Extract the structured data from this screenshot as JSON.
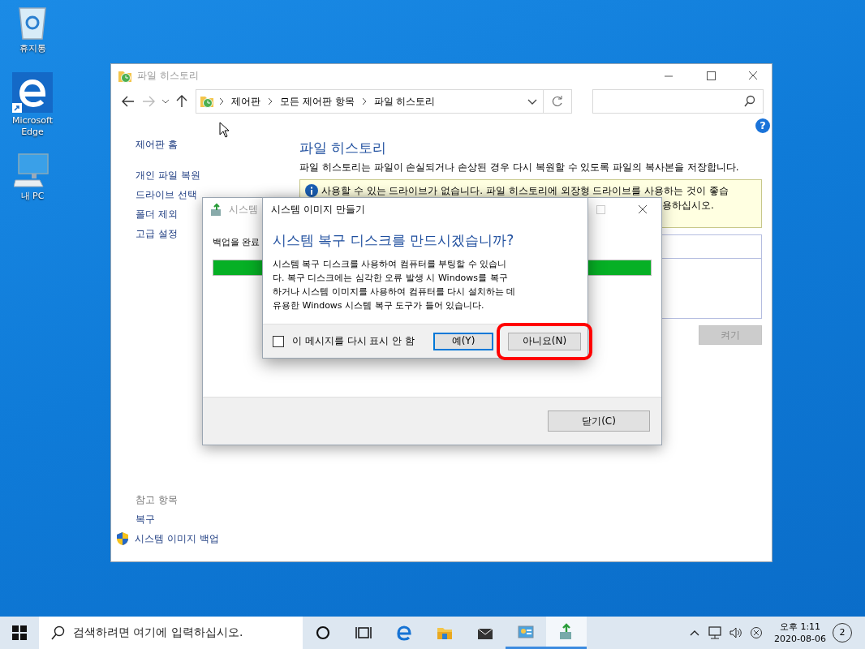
{
  "desktop": {
    "icons": [
      {
        "kind": "recycle",
        "label": "휴지통"
      },
      {
        "kind": "edge",
        "label": "Microsoft Edge"
      },
      {
        "kind": "pc",
        "label": "내 PC"
      }
    ]
  },
  "main_window": {
    "title": "파일 히스토리",
    "breadcrumb": [
      "제어판",
      "모든 제어판 항목",
      "파일 히스토리"
    ],
    "help_button": "?",
    "sidebar": {
      "items": [
        "제어판 홈",
        "개인 파일 복원",
        "드라이브 선택",
        "폴더 제외",
        "고급 설정"
      ],
      "see_also_title": "참고 항목",
      "see_also": [
        {
          "label": "복구",
          "shield": false
        },
        {
          "label": "시스템 이미지 백업",
          "shield": true
        }
      ]
    },
    "content": {
      "heading": "파일 히스토리",
      "description": "파일 히스토리는 파일이 손실되거나 손상된 경우 다시 복원할 수 있도록 파일의 복사본을 저장합니다.",
      "info_lines": [
        "사용할 수 있는 드라이브가 없습니다. 파일 히스토리에 외장형 드라이브를 사용하는 것이 좋습",
        "용하십시오."
      ],
      "button": {
        "label": "켜기",
        "disabled": true
      }
    }
  },
  "progress_window": {
    "title": "시스템",
    "message": "백업을 완료",
    "level": 1,
    "button": "닫기(C)"
  },
  "dialog": {
    "title": "시스템 이미지 만들기",
    "heading": "시스템 복구 디스크를 만드시겠습니까?",
    "body": "시스템 복구 디스크를 사용하여 컴퓨터를 부팅할 수 있습니다. 복구 디스크에는 심각한 오류 발생 시 Windows를 복구하거나 시스템 이미지를 사용하여 컴퓨터를 다시 설치하는 데 유용한 Windows 시스템 복구 도구가 들어 있습니다.",
    "checkbox": {
      "label": "이 메시지를 다시 표시 안 함",
      "checked": false
    },
    "buttons": [
      {
        "label": "예(Y)",
        "default": true,
        "highlighted": false
      },
      {
        "label": "아니요(N)",
        "default": false,
        "highlighted": true
      }
    ]
  },
  "taskbar": {
    "search_placeholder": "검색하려면 여기에 입력하십시오.",
    "apps": [
      {
        "kind": "cortana",
        "running": false,
        "selected": false
      },
      {
        "kind": "taskview",
        "running": false,
        "selected": false
      },
      {
        "kind": "edge",
        "running": false,
        "selected": false
      },
      {
        "kind": "explorer",
        "running": false,
        "selected": false
      },
      {
        "kind": "mail",
        "running": false,
        "selected": false
      },
      {
        "kind": "controlpanel",
        "running": true,
        "selected": false
      },
      {
        "kind": "backup",
        "running": true,
        "selected": true
      }
    ],
    "clock": {
      "time": "오후 1:11",
      "date": "2020-08-06"
    },
    "notifications": "2"
  }
}
